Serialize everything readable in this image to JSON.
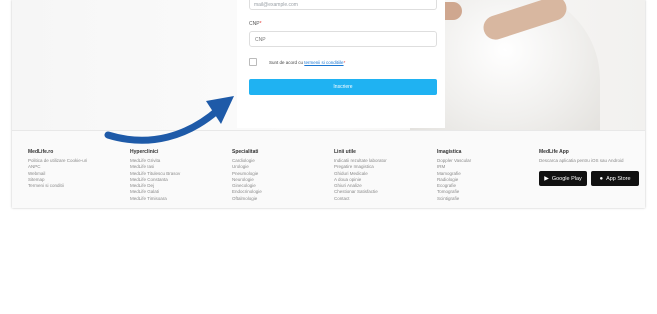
{
  "form": {
    "email_placeholder": "mail@example.com",
    "cnp_label": "CNP",
    "required_mark": "*",
    "cnp_placeholder": "CNP",
    "consent_prefix": "Sunt de acord cu",
    "consent_link": "termenii si conditiile",
    "submit_label": "Inscriere"
  },
  "footer": {
    "columns": [
      {
        "title": "MedLife.ro",
        "links": [
          "Politica de utilizare Cookie-uri",
          "ANPC",
          "Webmail",
          "Sitemap",
          "Termeni si conditii"
        ]
      },
      {
        "title": "Hyperclinici",
        "links": [
          "MedLife Grivita",
          "MedLife Iasi",
          "MedLife Titulescu Brasov",
          "MedLife Constanta",
          "MedLife Dej",
          "MedLife Galati",
          "MedLife Timisoara"
        ]
      },
      {
        "title": "Specialitati",
        "links": [
          "Cardiologie",
          "Urologie",
          "Pneumologie",
          "Neurologie",
          "Ginecologie",
          "Endocrinologie",
          "Oftalmologie"
        ]
      },
      {
        "title": "Linii utile",
        "links": [
          "Indicatii rezultate laborator",
          "Pregatire Imagistica",
          "Ghiduri Medicale",
          "A doua opinie",
          "Ghiuri Analize",
          "Chestionar Satisfactie",
          "Contact"
        ]
      },
      {
        "title": "Imagistica",
        "links": [
          "Doppler Vascular",
          "IRM",
          "Mamografie",
          "Radiologie",
          "Ecografie",
          "Tomografie",
          "Scintigrafie"
        ]
      },
      {
        "title": "MedLife App",
        "links": [
          "Descarca aplicatia pentru iOS sau Android"
        ]
      }
    ],
    "stores": {
      "google": "Google Play",
      "apple": "App Store"
    }
  },
  "colors": {
    "accent": "#1fb2f2",
    "arrow": "#1e5aa8",
    "link": "#1976d2"
  }
}
